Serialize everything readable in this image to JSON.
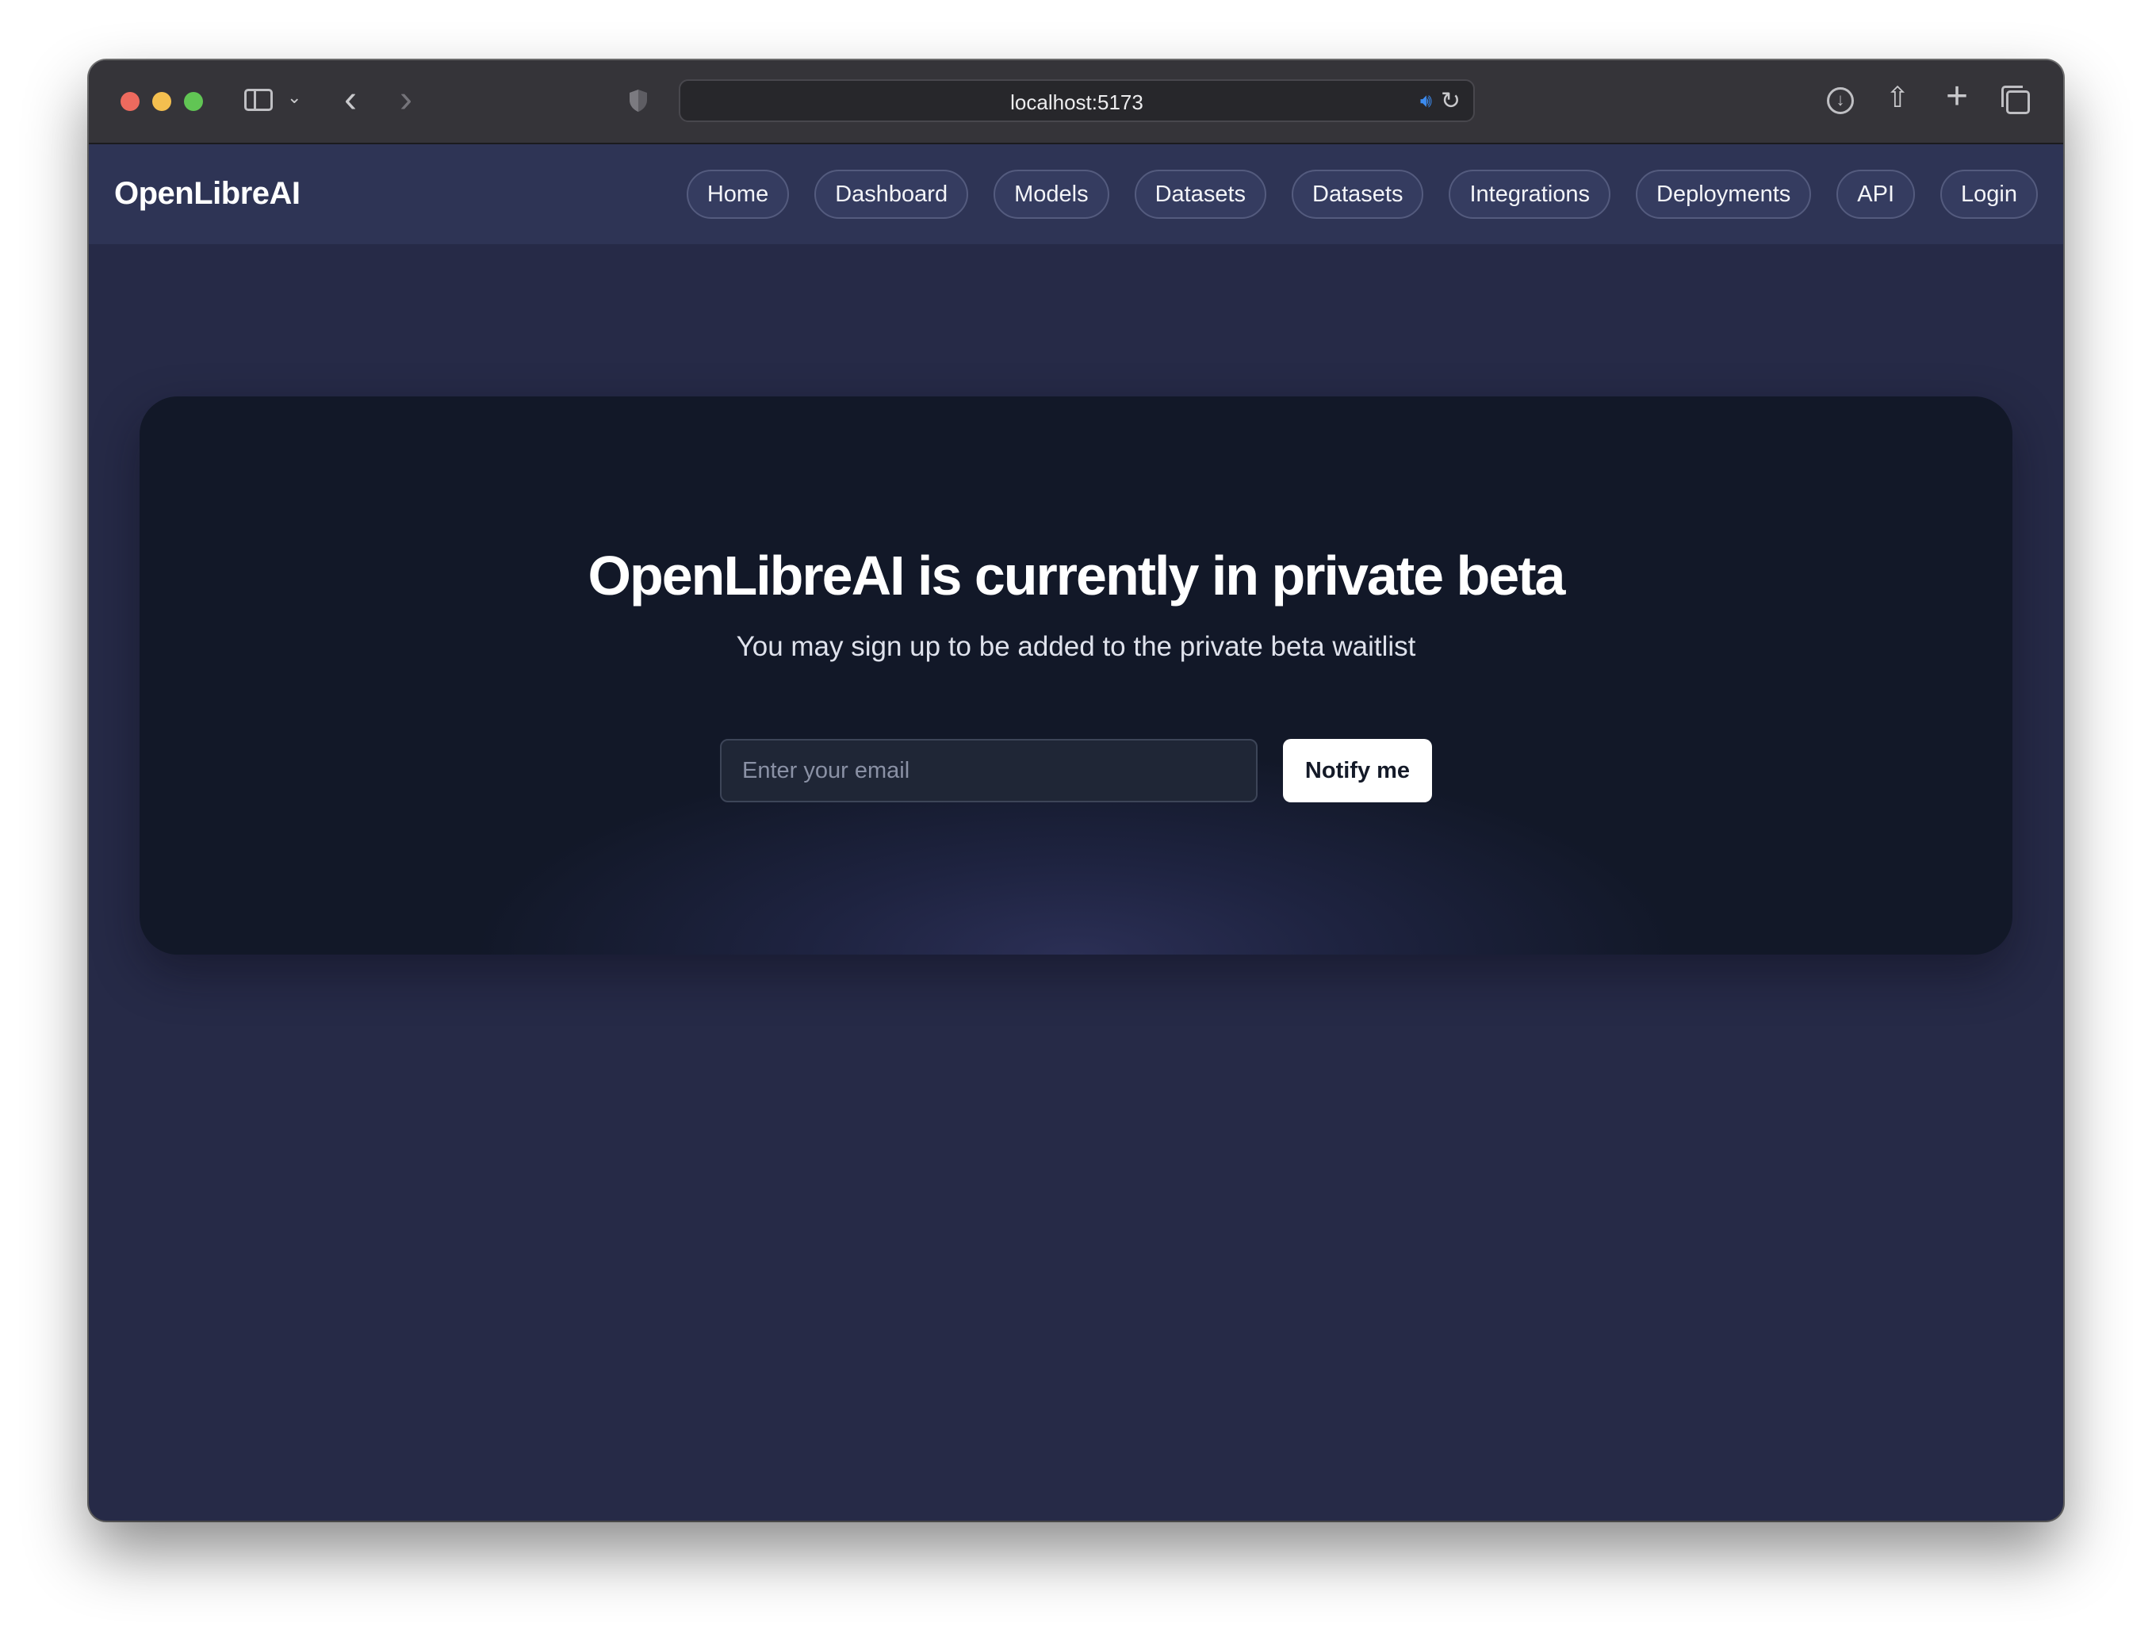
{
  "browser": {
    "url": "localhost:5173"
  },
  "nav": {
    "brand": "OpenLibreAI",
    "links": [
      "Home",
      "Dashboard",
      "Models",
      "Datasets",
      "Datasets",
      "Integrations",
      "Deployments",
      "API",
      "Login"
    ]
  },
  "hero": {
    "title": "OpenLibreAI is currently in private beta",
    "subtitle": "You may sign up to be added to the private beta waitlist",
    "email_placeholder": "Enter your email",
    "email_value": "",
    "button_label": "Notify me"
  },
  "icons": {
    "browser_chrome": [
      "close-window",
      "minimize-window",
      "maximize-window",
      "sidebar",
      "chevron-down",
      "back",
      "forward",
      "shield",
      "speaker",
      "reload",
      "download",
      "share",
      "new-tab",
      "tab-overview"
    ]
  },
  "colors": {
    "page_background": "#262a47",
    "nav_background": "#2e3455",
    "hero_background": "#121828",
    "button_background": "#ffffff"
  }
}
